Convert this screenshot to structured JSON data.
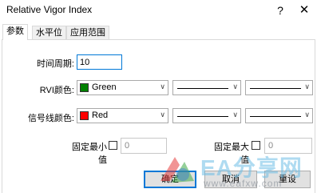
{
  "window": {
    "title": "Relative Vigor Index",
    "help_glyph": "?",
    "close_glyph": "✕"
  },
  "tabs": [
    {
      "label": "参数",
      "active": true
    },
    {
      "label": "水平位",
      "active": false
    },
    {
      "label": "应用范围",
      "active": false
    }
  ],
  "params": {
    "period_label": "时间周期:",
    "period_value": "10",
    "rvi_color_label": "RVI颜色:",
    "rvi_color": {
      "name": "Green",
      "hex": "#008000"
    },
    "signal_color_label": "信号线颜色:",
    "signal_color": {
      "name": "Red",
      "hex": "#ff0000"
    },
    "min_label": "固定最小值",
    "min_value": "0",
    "min_checked": false,
    "max_label": "固定最大值",
    "max_value": "0",
    "max_checked": false
  },
  "buttons": {
    "ok": "确定",
    "cancel": "取消",
    "reset": "重设"
  },
  "watermark": {
    "text": "EA分享网",
    "url": "www.eafxw.com"
  }
}
